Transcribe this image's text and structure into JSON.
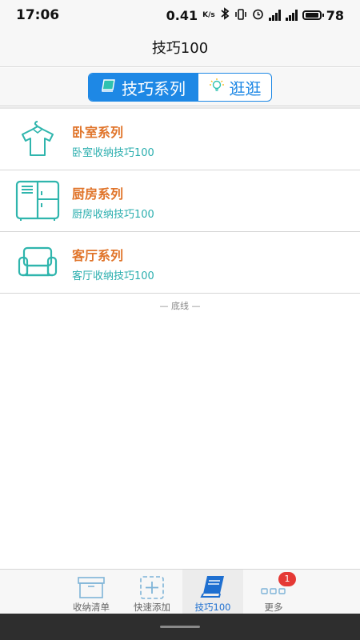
{
  "status_bar": {
    "time": "17:06",
    "net_speed": "0.41",
    "net_unit": "K/s",
    "battery": "78",
    "icons": [
      "bluetooth-icon",
      "vibrate-icon",
      "alarm-icon",
      "signal-icon",
      "signal-icon",
      "battery-icon"
    ]
  },
  "header": {
    "title": "技巧100"
  },
  "tabs": [
    {
      "label": "技巧系列",
      "icon": "book-icon",
      "active": true
    },
    {
      "label": "逛逛",
      "icon": "lightbulb-icon",
      "active": false
    }
  ],
  "series": [
    {
      "title": "卧室系列",
      "subtitle": "卧室收纳技巧100",
      "icon": "shirt-icon"
    },
    {
      "title": "厨房系列",
      "subtitle": "厨房收纳技巧100",
      "icon": "fridge-icon"
    },
    {
      "title": "客厅系列",
      "subtitle": "客厅收纳技巧100",
      "icon": "sofa-icon"
    }
  ],
  "footer_text": "— 底线 —",
  "bottom_nav": [
    {
      "label": "收纳清单",
      "icon": "storage-box-icon",
      "active": false
    },
    {
      "label": "快速添加",
      "icon": "quick-add-icon",
      "active": false
    },
    {
      "label": "技巧100",
      "icon": "book-icon",
      "active": true
    },
    {
      "label": "更多",
      "icon": "more-icon",
      "active": false,
      "badge": "1"
    }
  ],
  "colors": {
    "accent": "#1e88e5",
    "title_orange": "#e0742a",
    "subtitle_teal": "#2aaeae",
    "icon_teal": "#2fb5ad",
    "badge_red": "#e53935"
  }
}
